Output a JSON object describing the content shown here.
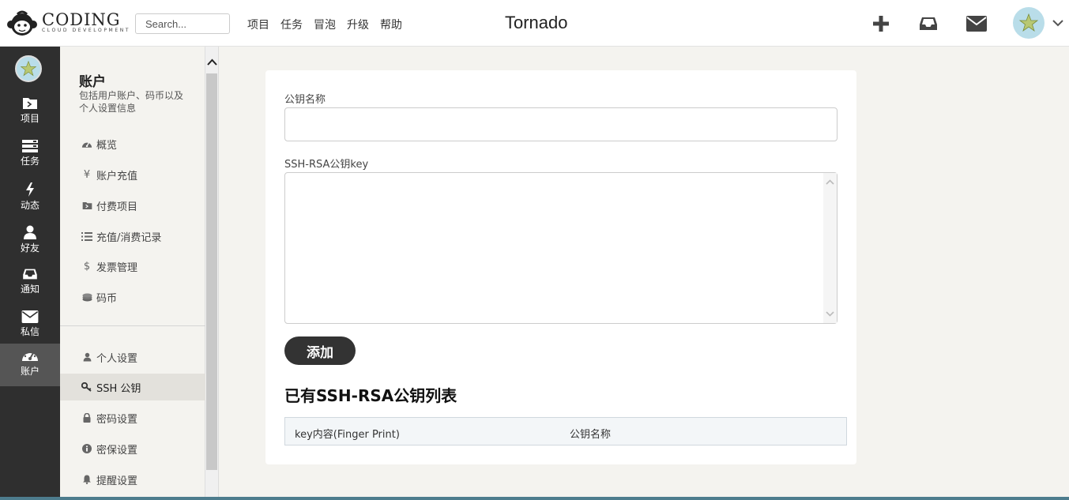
{
  "header": {
    "logo_text": "CODING",
    "logo_sub": "CLOUD DEVELOPMENT",
    "search_placeholder": "Search...",
    "nav": [
      "项目",
      "任务",
      "冒泡",
      "升级",
      "帮助"
    ],
    "title": "Tornado",
    "icons": [
      "plus-icon",
      "inbox-icon",
      "mail-icon"
    ]
  },
  "rail": {
    "items": [
      {
        "label": "项目",
        "icon": "project-icon"
      },
      {
        "label": "任务",
        "icon": "tasks-icon"
      },
      {
        "label": "动态",
        "icon": "bolt-icon"
      },
      {
        "label": "好友",
        "icon": "user-icon"
      },
      {
        "label": "通知",
        "icon": "inbox-icon"
      },
      {
        "label": "私信",
        "icon": "mail-icon"
      },
      {
        "label": "账户",
        "icon": "dashboard-icon",
        "active": true
      }
    ]
  },
  "sidebar": {
    "title": "账户",
    "description": "包括用户账户、码币以及个人设置信息",
    "items": [
      {
        "label": "概览",
        "icon": "dashboard-icon"
      },
      {
        "label": "账户充值",
        "icon": "yen-icon"
      },
      {
        "label": "付费项目",
        "icon": "project-icon"
      },
      {
        "label": "充值/消费记录",
        "icon": "list-icon"
      },
      {
        "label": "发票管理",
        "icon": "dollar-icon"
      },
      {
        "label": "码币",
        "icon": "coins-icon"
      }
    ],
    "settings": [
      {
        "label": "个人设置",
        "icon": "user-icon"
      },
      {
        "label": "SSH 公钥",
        "icon": "key-icon",
        "active": true
      },
      {
        "label": "密码设置",
        "icon": "lock-icon"
      },
      {
        "label": "密保设置",
        "icon": "info-icon"
      },
      {
        "label": "提醒设置",
        "icon": "bell-icon"
      }
    ]
  },
  "form": {
    "name_label": "公钥名称",
    "name_value": "",
    "key_label": "SSH-RSA公钥key",
    "key_value": "",
    "submit_label": "添加"
  },
  "list": {
    "title": "已有SSH-RSA公钥列表",
    "columns": [
      "key内容(Finger Print)",
      "公钥名称"
    ],
    "rows": []
  },
  "colors": {
    "rail_bg": "#2f2f2f",
    "page_bg": "#f4f3ef",
    "button_bg": "#333333",
    "table_header_bg": "#f3f6f8"
  }
}
